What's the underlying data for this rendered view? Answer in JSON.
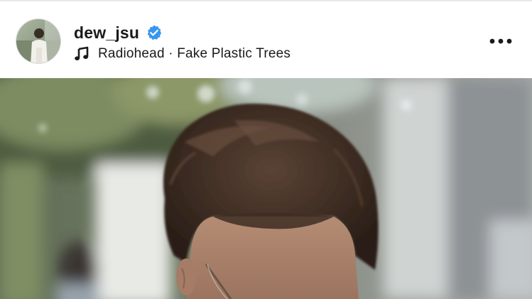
{
  "post": {
    "username": "dew_jsu",
    "music_artist": "Radiohead",
    "music_separator": " · ",
    "music_track": "Fake Plastic Trees"
  },
  "icons": {
    "verified": "verified-badge-icon",
    "music": "music-note-icon",
    "more": "more-options-icon"
  },
  "colors": {
    "verified_blue": "#3797f0",
    "text": "#1a1a1a"
  }
}
